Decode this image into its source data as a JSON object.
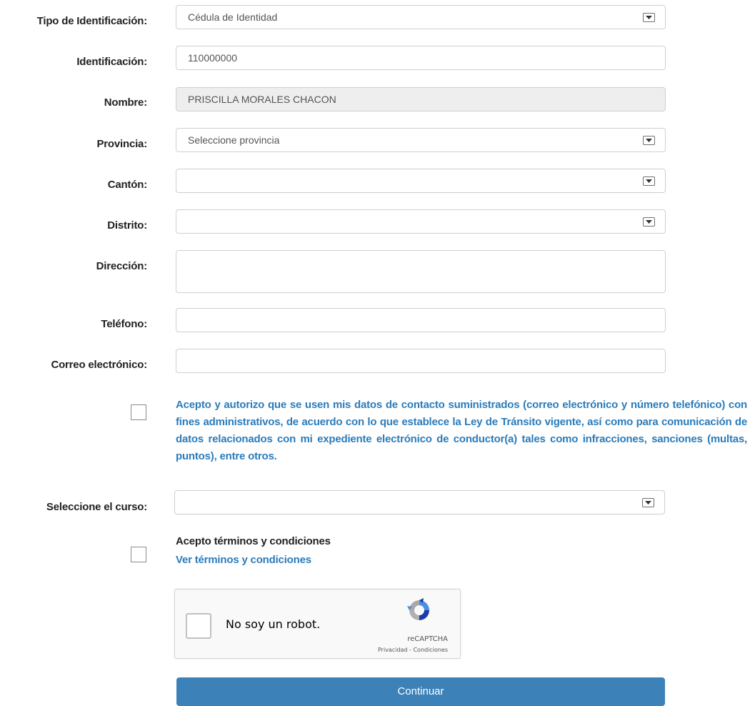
{
  "form": {
    "tipo_label": "Tipo de Identificación:",
    "tipo_value": "Cédula de Identidad",
    "identificacion_label": "Identificación:",
    "identificacion_value": "110000000",
    "nombre_label": "Nombre:",
    "nombre_value": "PRISCILLA MORALES CHACON",
    "provincia_label": "Provincia:",
    "provincia_value": "Seleccione provincia",
    "canton_label": "Cantón:",
    "canton_value": "",
    "distrito_label": "Distrito:",
    "distrito_value": "",
    "direccion_label": "Dirección:",
    "direccion_value": "",
    "telefono_label": "Teléfono:",
    "telefono_value": "",
    "correo_label": "Correo electrónico:",
    "correo_value": "",
    "consent_text": "Acepto y autorizo que se usen mis datos de contacto suministrados (correo electrónico y número telefónico) con fines administrativos, de acuerdo con lo que establece la Ley de Tránsito vigente, así como para comunicación de datos relacionados con mi expediente electrónico de conductor(a) tales como infracciones, sanciones (multas, puntos), entre otros.",
    "consent_checked": false,
    "curso_label": "Seleccione el curso:",
    "curso_value": "",
    "terms_title": "Acepto términos y condiciones",
    "terms_link": "Ver términos y condiciones",
    "terms_checked": false
  },
  "captcha": {
    "label": "No soy un robot.",
    "brand": "reCAPTCHA",
    "links": "Privacidad - Condiciones"
  },
  "submit_label": "Continuar",
  "colors": {
    "accent": "#2b7cbb",
    "button": "#3c82b8",
    "readonly_bg": "#eeeeee",
    "label": "#222222"
  },
  "icons": [
    "chevron-down-icon",
    "recaptcha-logo-icon"
  ]
}
